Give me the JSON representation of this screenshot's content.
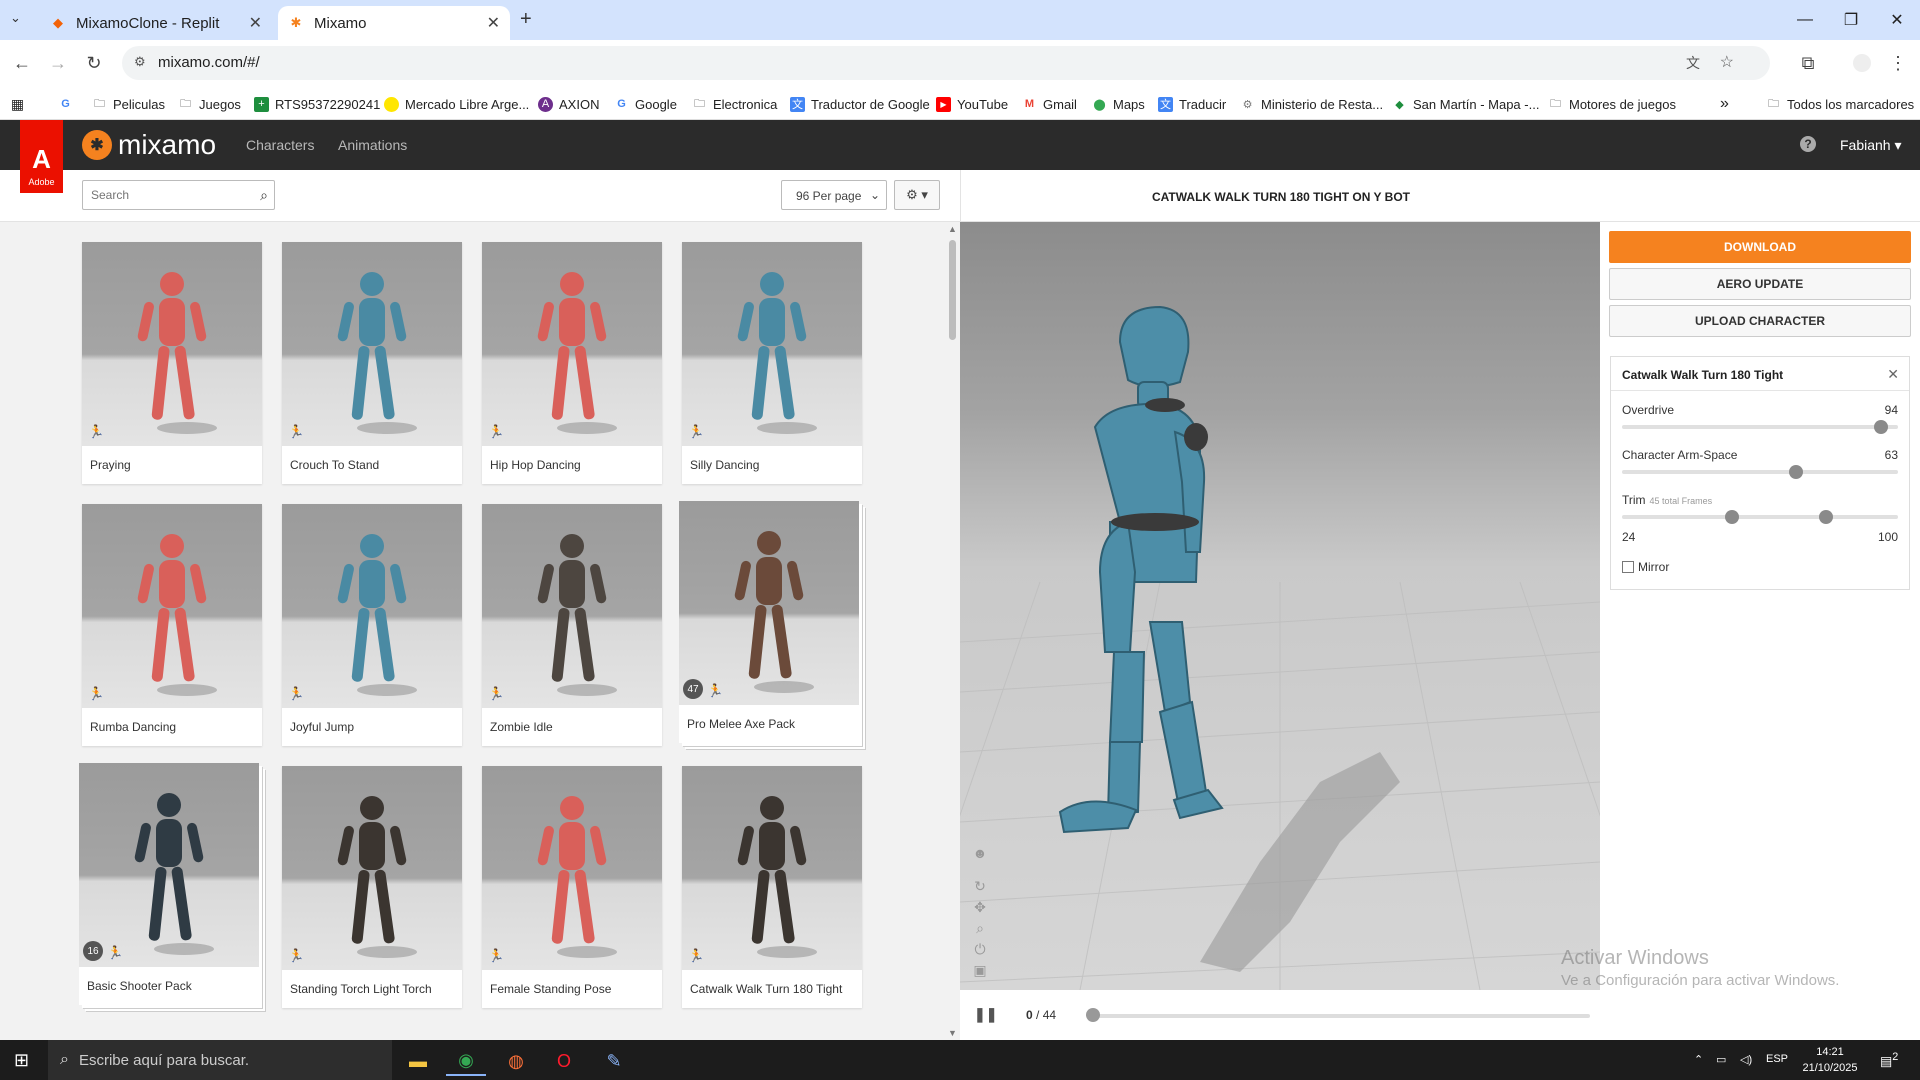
{
  "browser": {
    "tabs": [
      {
        "title": "MixamoClone - Replit",
        "active": false
      },
      {
        "title": "Mixamo",
        "active": true
      }
    ],
    "url": "mixamo.com/#/",
    "bookmarks": [
      "Peliculas",
      "Juegos",
      "RTS95372290241",
      "Mercado Libre Arge...",
      "AXION",
      "Google",
      "Electronica",
      "Traductor de Google",
      "YouTube",
      "Gmail",
      "Maps",
      "Traducir",
      "Ministerio de Resta...",
      "San Martín - Mapa -...",
      "Motores de juegos"
    ],
    "all_bookmarks": "Todos los marcadores",
    "overflow": "»"
  },
  "app": {
    "brand": "mixamo",
    "adobe_label": "Adobe",
    "nav": [
      "Characters",
      "Animations"
    ],
    "user": "Fabianh",
    "help": "?"
  },
  "toolbar": {
    "search_placeholder": "Search",
    "per_page": "96 Per page"
  },
  "gallery": {
    "items": [
      {
        "label": "Praying",
        "color": "#d9605a"
      },
      {
        "label": "Crouch To Stand",
        "color": "#4a8aa3"
      },
      {
        "label": "Hip Hop Dancing",
        "color": "#d9605a"
      },
      {
        "label": "Silly Dancing",
        "color": "#4a8aa3"
      },
      {
        "label": "Rumba Dancing",
        "color": "#d9605a"
      },
      {
        "label": "Joyful Jump",
        "color": "#4a8aa3"
      },
      {
        "label": "Zombie Idle",
        "color": "#4d4640"
      },
      {
        "label": "Pro Melee Axe Pack",
        "color": "#6b4a3a",
        "badge": "47"
      },
      {
        "label": "Basic Shooter Pack",
        "color": "#2f3b44",
        "badge": "16"
      },
      {
        "label": "Standing Torch Light Torch",
        "color": "#3b3530"
      },
      {
        "label": "Female Standing Pose",
        "color": "#d9605a"
      },
      {
        "label": "Catwalk Walk Turn 180 Tight",
        "color": "#3b3530"
      }
    ]
  },
  "viewer": {
    "title": "CATWALK WALK TURN 180 TIGHT ON Y BOT",
    "frame_current": "0",
    "frame_total": "/ 44",
    "progress": 0
  },
  "actions": {
    "download": "DOWNLOAD",
    "aero_update": "AERO UPDATE",
    "upload": "UPLOAD CHARACTER"
  },
  "settings": {
    "title": "Catwalk Walk Turn 180 Tight",
    "overdrive_label": "Overdrive",
    "overdrive_value": "94",
    "overdrive_fraction": 0.94,
    "armspace_label": "Character Arm-Space",
    "armspace_value": "63",
    "armspace_fraction": 0.63,
    "trim_label": "Trim",
    "trim_note": "45 total Frames",
    "trim_min": "24",
    "trim_max": "100",
    "trim_low_fraction": 0.4,
    "trim_high_fraction": 0.74,
    "mirror_label": "Mirror"
  },
  "watermark": {
    "line1": "Activar Windows",
    "line2": "Ve a Configuración para activar Windows."
  },
  "taskbar": {
    "search_placeholder": "Escribe aquí para buscar.",
    "lang": "ESP",
    "time": "14:21",
    "date": "21/10/2025",
    "notifications": "2"
  },
  "colors": {
    "accent": "#f5821f",
    "header": "#2b2b2b",
    "adobe_red": "#eb1000"
  }
}
